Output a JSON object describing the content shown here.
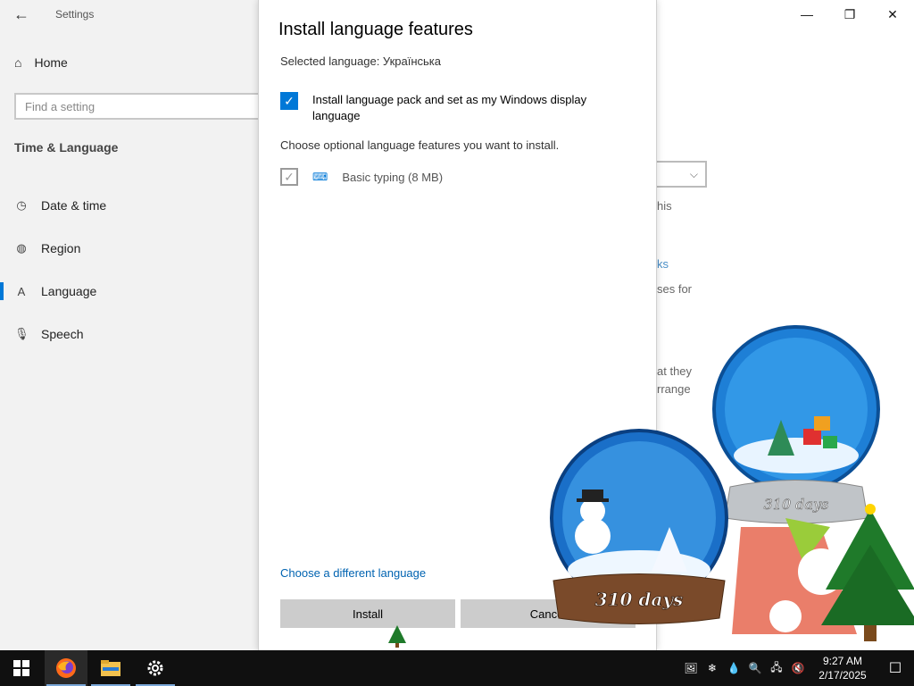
{
  "window": {
    "title": "Settings",
    "back_icon": "←",
    "minimize_icon": "—",
    "maximize_icon": "❐",
    "close_icon": "✕"
  },
  "sidebar": {
    "home_icon": "⌂",
    "home_label": "Home",
    "search_placeholder": "Find a setting",
    "section_title": "Time & Language",
    "items": [
      {
        "label": "Date & time",
        "icon": "◷"
      },
      {
        "label": "Region",
        "icon": "◍"
      },
      {
        "label": "Language",
        "icon": "A"
      },
      {
        "label": "Speech",
        "icon": "🎙"
      }
    ]
  },
  "background_fragments": {
    "dropdown_chevron": "⌵",
    "f1": "his",
    "f2": "ks",
    "f3": "ses for",
    "f4": "at they",
    "f5": "rrange"
  },
  "dialog": {
    "title": "Install language features",
    "selected_language": "Selected language: Українська",
    "install_pack_checked": true,
    "install_pack_label": "Install language pack and set as my Windows display language",
    "choose_text": "Choose optional language features you want to install.",
    "feature_label": "Basic typing (8 MB)",
    "feature_checked": true,
    "check_glyph": "✓",
    "keyboard_icon": "⌨",
    "different_language_link": "Choose a different language",
    "install_button": "Install",
    "cancel_button": "Cancel"
  },
  "decorations": {
    "globe_label_front": "310 days",
    "globe_label_back": "310 days"
  },
  "taskbar": {
    "time": "9:27 AM",
    "date": "2/17/2025",
    "notification_icon": "☐",
    "tray_icons": [
      "🖼",
      "❄",
      "💧",
      "🔍",
      "🖧",
      "🔇"
    ]
  },
  "colors": {
    "accent": "#0078d7",
    "sidebar_bg": "#f2f2f2",
    "taskbar_bg": "#101010",
    "button_bg": "#cccccc",
    "link": "#0063b1"
  }
}
